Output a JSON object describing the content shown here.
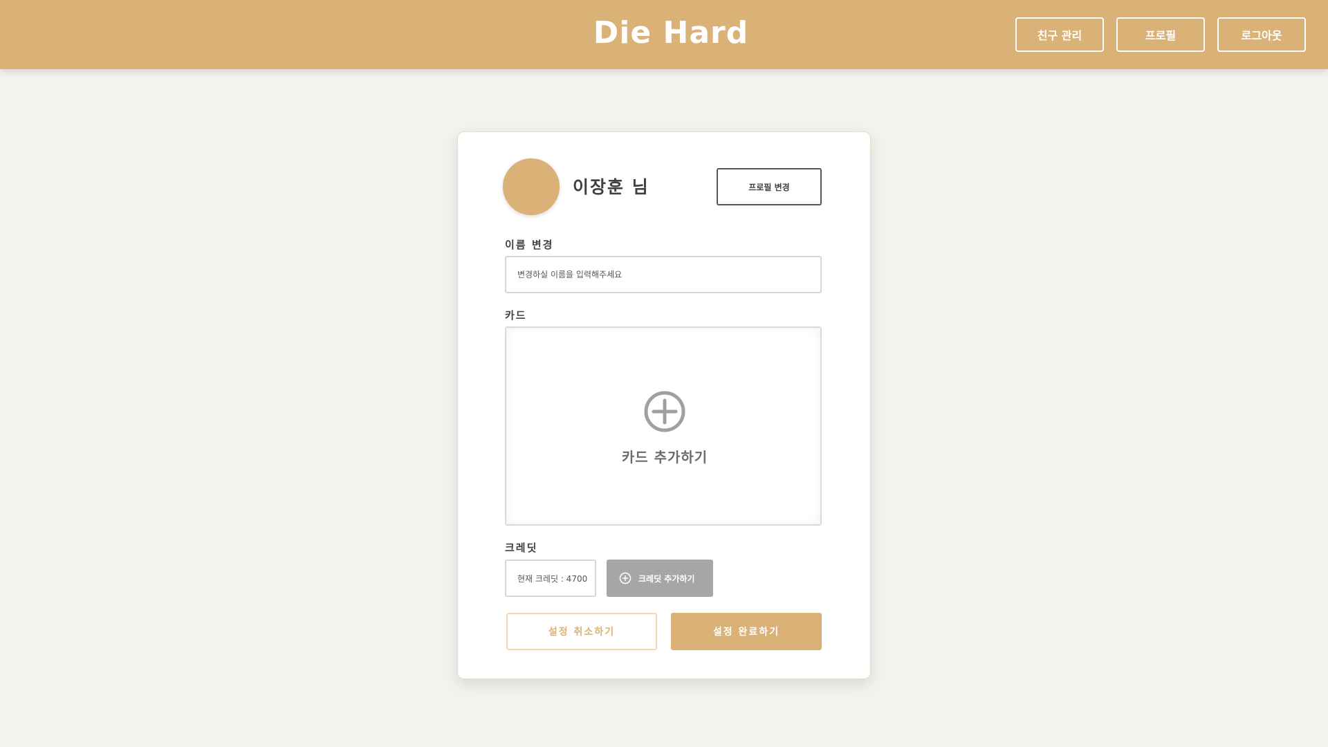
{
  "header": {
    "logo": "Die Hard",
    "nav": {
      "friends_label": "친구 관리",
      "profile_label": "프로필",
      "logout_label": "로그아웃"
    }
  },
  "profile": {
    "user_name": "이장훈 님",
    "change_profile_label": "프로필 변경",
    "name_change": {
      "label": "이름 변경",
      "placeholder": "변경하실 이름을 입력해주세요",
      "value": ""
    },
    "card": {
      "label": "카드",
      "add_label": "카드 추가하기",
      "add_icon": "plus-circle-icon"
    },
    "credit": {
      "label": "크레딧",
      "current_text": "현재 크레딧 : 4700",
      "add_label": "크레딧 추가하기",
      "add_icon": "plus-circle-icon"
    },
    "actions": {
      "cancel_label": "설정 취소하기",
      "confirm_label": "설정 완료하기"
    }
  },
  "colors": {
    "brand": "#dab177",
    "background": "#f4f2ed",
    "gray_button": "#a6a6a6",
    "text": "#404040"
  }
}
